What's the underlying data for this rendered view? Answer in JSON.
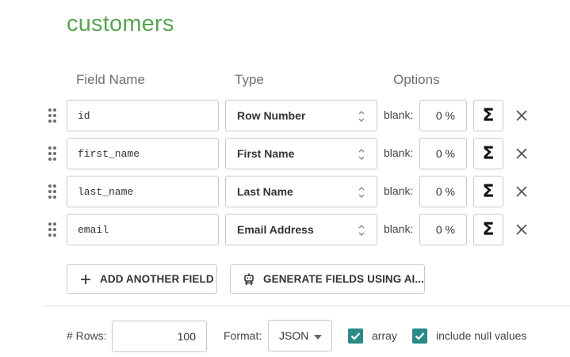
{
  "table": {
    "title": "customers"
  },
  "columns": {
    "field_name": "Field Name",
    "type": "Type",
    "options": "Options"
  },
  "fields": [
    {
      "name": "id",
      "type": "Row Number",
      "blank_label": "blank:",
      "blank_value": "0 %"
    },
    {
      "name": "first_name",
      "type": "First Name",
      "blank_label": "blank:",
      "blank_value": "0 %"
    },
    {
      "name": "last_name",
      "type": "Last Name",
      "blank_label": "blank:",
      "blank_value": "0 %"
    },
    {
      "name": "email",
      "type": "Email Address",
      "blank_label": "blank:",
      "blank_value": "0 %"
    }
  ],
  "icons": {
    "drag": "drag-handle-icon",
    "sort": "updown-chevron-icon",
    "sigma": "sigma-icon",
    "remove": "close-icon",
    "add": "plus-icon",
    "ai": "robot-icon",
    "caret": "caret-down-icon",
    "check": "checkmark-icon"
  },
  "sigma_glyph": "Σ",
  "actions": {
    "add_field": "ADD ANOTHER FIELD",
    "generate_ai": "GENERATE FIELDS USING AI..."
  },
  "footer": {
    "rows_label": "# Rows:",
    "rows_value": "100",
    "format_label": "Format:",
    "format_value": "JSON",
    "array_label": "array",
    "array_checked": true,
    "include_null_label": "include null values",
    "include_null_checked": true
  },
  "colors": {
    "title": "#5aa454",
    "checkbox": "#2a8a88",
    "border": "#c9c9c9"
  }
}
